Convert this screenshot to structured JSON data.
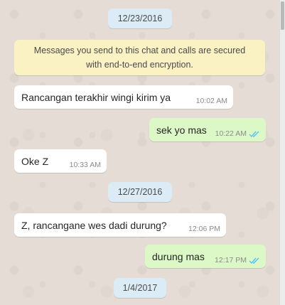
{
  "dates": [
    "12/23/2016",
    "12/27/2016",
    "1/4/2017"
  ],
  "notice": {
    "line1": "Messages you send to this chat and calls are secured",
    "line2": "with end-to-end encryption."
  },
  "messages": [
    {
      "text": "Rancangan terakhir wingi kirim ya",
      "time": "10:02 AM"
    },
    {
      "text": "sek yo mas",
      "time": "10:22 AM"
    },
    {
      "text": "Oke Z",
      "time": "10:33 AM"
    },
    {
      "text": "Z, rancangane wes dadi durung?",
      "time": "12:06 PM"
    },
    {
      "text": "durung mas",
      "time": "12:17 PM"
    }
  ],
  "colors": {
    "incoming": "#ffffff",
    "outgoing": "#dcf8c6",
    "read_ticks": "#4fc3f7",
    "date_chip": "#dcecf6",
    "notice": "#fbf2c4"
  }
}
